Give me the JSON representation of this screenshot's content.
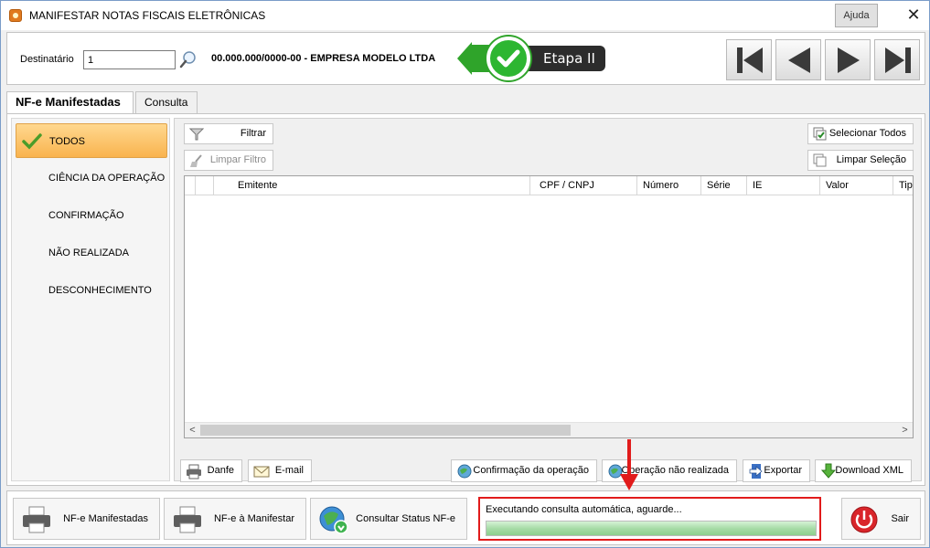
{
  "window": {
    "title": "MANIFESTAR NOTAS FISCAIS ELETRÔNICAS",
    "help_label": "Ajuda",
    "close_label": "✕"
  },
  "header": {
    "recipient_label": "Destinatário",
    "recipient_value": "1",
    "company": "00.000.000/0000-00 - EMPRESA MODELO LTDA",
    "step_badge": "Etapa II"
  },
  "tabs": [
    {
      "label": "NF-e Manifestadas",
      "active": true
    },
    {
      "label": "Consulta",
      "active": false
    }
  ],
  "sidebar": {
    "items": [
      {
        "label": "TODOS",
        "active": true
      },
      {
        "label": "CIÊNCIA DA OPERAÇÃO"
      },
      {
        "label": "CONFIRMAÇÃO"
      },
      {
        "label": "NÃO REALIZADA"
      },
      {
        "label": "DESCONHECIMENTO"
      }
    ]
  },
  "toolbar": {
    "filter_label": "Filtrar",
    "clear_filter_label": "Limpar Filtro",
    "select_all_label": "Selecionar Todos",
    "clear_selection_label": "Limpar Seleção"
  },
  "grid": {
    "columns": [
      "",
      "",
      "Emitente",
      "CPF / CNPJ",
      "Número",
      "Série",
      "IE",
      "Valor",
      "Tipo"
    ]
  },
  "actions": {
    "danfe_label": "Danfe",
    "email_label": "E-mail",
    "confirm_label": "Confirmação da operação",
    "not_done_label": "Operação não realizada",
    "export_label": "Exportar",
    "download_label": "Download XML"
  },
  "footer": {
    "btn_manifested": "NF-e Manifestadas",
    "btn_to_manifest": "NF-e à Manifestar",
    "btn_status": "Consultar Status NF-e",
    "status_text": "Executando consulta automática, aguarde...",
    "progress": 1.0,
    "exit_label": "Sair"
  },
  "colors": {
    "accent_orange": "#f9b34e",
    "highlight_red": "#e11b1b",
    "step_green": "#2fa42a"
  }
}
